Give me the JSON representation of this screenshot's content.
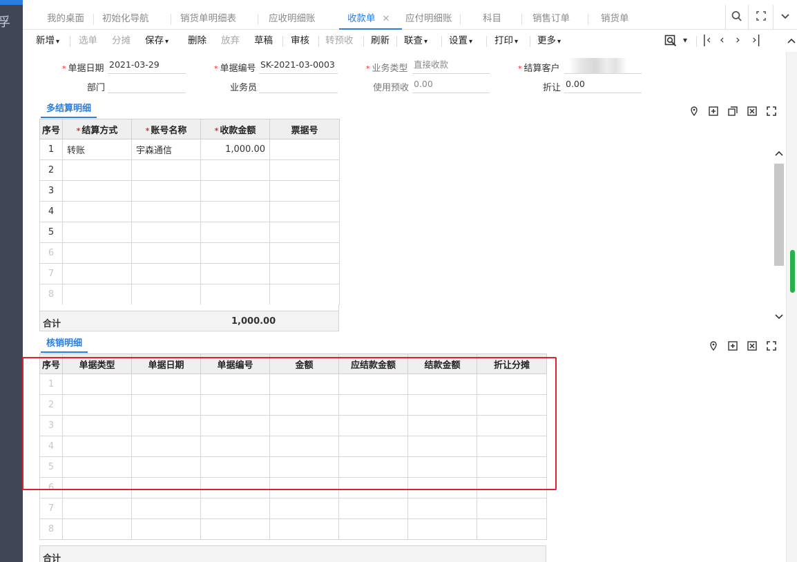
{
  "tabs": [
    {
      "label": "我的桌面"
    },
    {
      "label": "初始化导航"
    },
    {
      "label": "销货单明细表"
    },
    {
      "label": "应收明细账"
    },
    {
      "label": "收款单"
    },
    {
      "label": "应付明细账"
    },
    {
      "label": "科目"
    },
    {
      "label": "销售订单"
    },
    {
      "label": "销货单"
    }
  ],
  "toolbar": {
    "new": "新增",
    "select": "选单",
    "allocate": "分摊",
    "save": "保存",
    "delete": "删除",
    "discard": "放弃",
    "draft": "草稿",
    "audit": "审核",
    "prepay": "转预收",
    "refresh": "刷新",
    "linked": "联查",
    "settings": "设置",
    "print": "打印",
    "more": "更多"
  },
  "form": {
    "date_label": "单据日期",
    "date_value": "2021-03-29",
    "no_label": "单据编号",
    "no_value": "SK-2021-03-0003",
    "biz_label": "业务类型",
    "biz_value": "直接收款",
    "cust_label": "结算客户",
    "dept_label": "部门",
    "staff_label": "业务员",
    "prepay_label": "使用预收",
    "prepay_value": "0.00",
    "discount_label": "折让",
    "discount_value": "0.00"
  },
  "settlement": {
    "title": "多结算明细",
    "headers": {
      "no": "序号",
      "method": "结算方式",
      "account": "账号名称",
      "amount": "收款金额",
      "ticket": "票据号"
    },
    "rows": [
      {
        "no": "1",
        "method": "转账",
        "account": "宇森通信",
        "amount": "1,000.00",
        "ticket": ""
      },
      {
        "no": "2"
      },
      {
        "no": "3"
      },
      {
        "no": "4"
      },
      {
        "no": "5"
      },
      {
        "no": "6"
      },
      {
        "no": "7"
      },
      {
        "no": "8"
      }
    ],
    "total_label": "合计",
    "total_amount": "1,000.00"
  },
  "writeoff": {
    "title": "核销明细",
    "headers": [
      "序号",
      "单据类型",
      "单据日期",
      "单据编号",
      "金额",
      "应结款金额",
      "结款金额",
      "折让分摊"
    ],
    "rows": [
      "1",
      "2",
      "3",
      "4",
      "5",
      "6",
      "7",
      "8"
    ],
    "total_label": "合计"
  },
  "colors": {
    "accent": "#2a7de1",
    "highlight": "#e0202a",
    "required": "#e23",
    "scroll_handle": "#27b14d"
  }
}
